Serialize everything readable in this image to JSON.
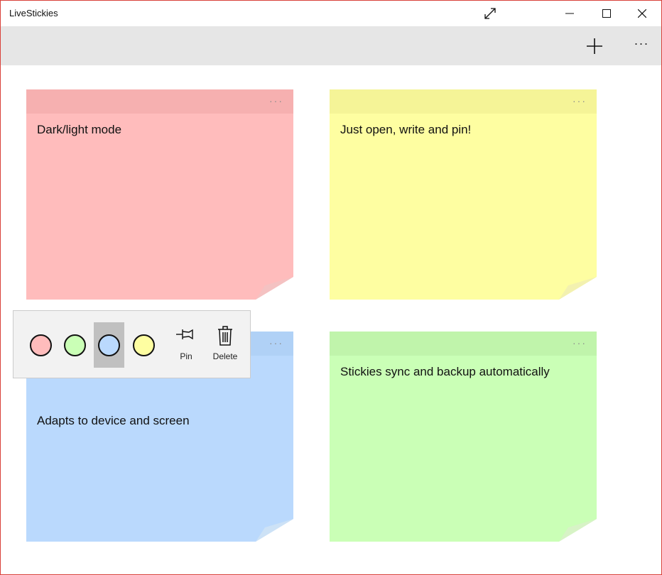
{
  "window": {
    "title": "LiveStickies"
  },
  "titlebar": {
    "expand_icon": "expand-icon",
    "minimize_icon": "minimize-icon",
    "maximize_icon": "maximize-icon",
    "close_icon": "close-icon"
  },
  "commandbar": {
    "add_icon": "plus-icon",
    "more_label": "···"
  },
  "notes": [
    {
      "text": "Dark/light mode",
      "menu": "···",
      "color": "#ffbcbc",
      "header_color": "#f6b0b0",
      "fold_color": "#f4c2c2"
    },
    {
      "text": "Just open, write and pin!",
      "menu": "···",
      "color": "#fefea1",
      "header_color": "#f5f497",
      "fold_color": "#f3f1b0"
    },
    {
      "text": "Adapts to device and screen",
      "menu": "···",
      "color": "#bad9fd",
      "header_color": "#b0d1f6",
      "fold_color": "#cde2f6"
    },
    {
      "text": "Stickies sync and backup automatically",
      "menu": "···",
      "color": "#caffb6",
      "header_color": "#c0f4ab",
      "fold_color": "#d7f3c6"
    }
  ],
  "flyout": {
    "colors": [
      {
        "name": "red",
        "hex": "#ffbcbc",
        "selected": false
      },
      {
        "name": "green",
        "hex": "#caffb6",
        "selected": false
      },
      {
        "name": "blue",
        "hex": "#bad9fd",
        "selected": true
      },
      {
        "name": "yellow",
        "hex": "#fefea1",
        "selected": false
      }
    ],
    "pin_label": "Pin",
    "delete_label": "Delete",
    "pin_icon": "pin-icon",
    "delete_icon": "trash-icon"
  }
}
